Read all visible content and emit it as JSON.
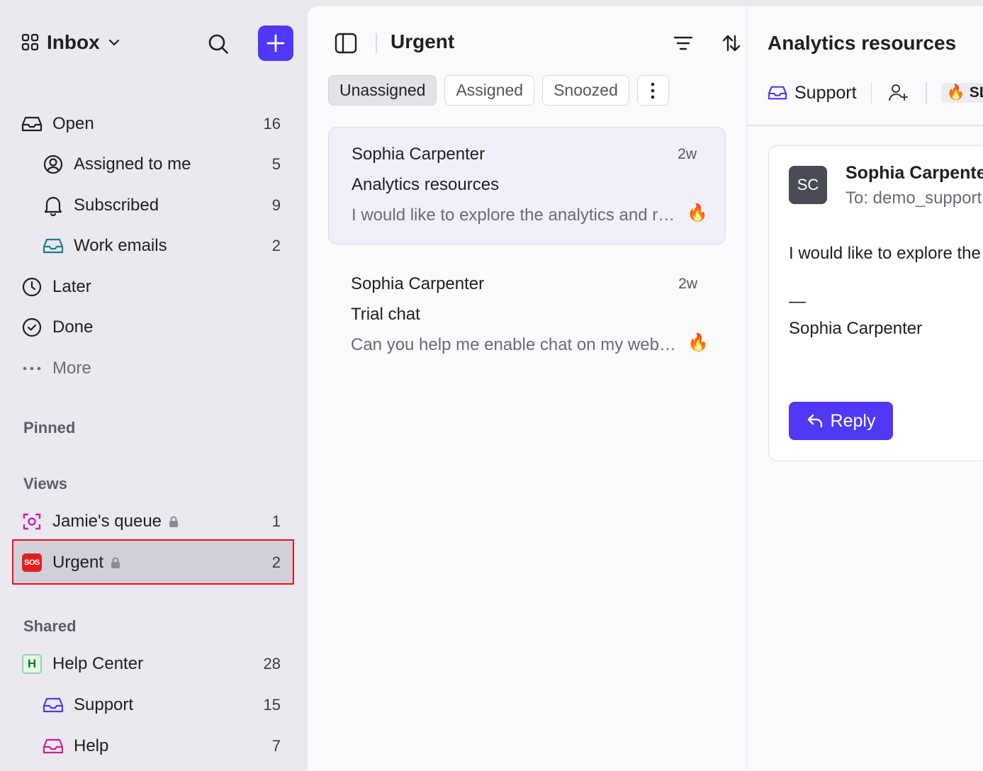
{
  "sidebar": {
    "inbox_title": "Inbox",
    "items": [
      {
        "label": "Open",
        "count": "16"
      },
      {
        "label": "Assigned to me",
        "count": "5"
      },
      {
        "label": "Subscribed",
        "count": "9"
      },
      {
        "label": "Work emails",
        "count": "2"
      },
      {
        "label": "Later",
        "count": ""
      },
      {
        "label": "Done",
        "count": ""
      },
      {
        "label": "More",
        "count": ""
      }
    ],
    "pinned_title": "Pinned",
    "views_title": "Views",
    "views": [
      {
        "label": "Jamie's queue",
        "count": "1"
      },
      {
        "label": "Urgent",
        "count": "2",
        "badge": "SOS"
      }
    ],
    "shared_title": "Shared",
    "shared": [
      {
        "label": "Help Center",
        "count": "28",
        "badge": "H"
      },
      {
        "label": "Support",
        "count": "15"
      },
      {
        "label": "Help",
        "count": "7"
      }
    ]
  },
  "list": {
    "title": "Urgent",
    "tabs": [
      "Unassigned",
      "Assigned",
      "Snoozed"
    ],
    "active_tab": "Unassigned",
    "conversations": [
      {
        "name": "Sophia Carpenter",
        "time": "2w",
        "subject": "Analytics resources",
        "preview": "I would like to explore the analytics and reporting options",
        "flag": "🔥"
      },
      {
        "name": "Sophia Carpenter",
        "time": "2w",
        "subject": "Trial chat",
        "preview": "Can you help me enable chat on my website",
        "flag": "🔥"
      }
    ]
  },
  "detail": {
    "title": "Analytics resources",
    "team": "Support",
    "sla_label": "SLA",
    "sla_icon": "🔥",
    "message": {
      "avatar": "SC",
      "sender": "Sophia Carpenter",
      "to": "To: demo_support@example.com",
      "body": "I would like to explore the analytics and reporting options",
      "dash": "—",
      "signature": "Sophia Carpenter"
    },
    "reply_label": "Reply"
  },
  "colors": {
    "accent": "#4f39f6",
    "highlight_border": "#e0161b",
    "sidebar_bg": "#ebe8ef"
  }
}
